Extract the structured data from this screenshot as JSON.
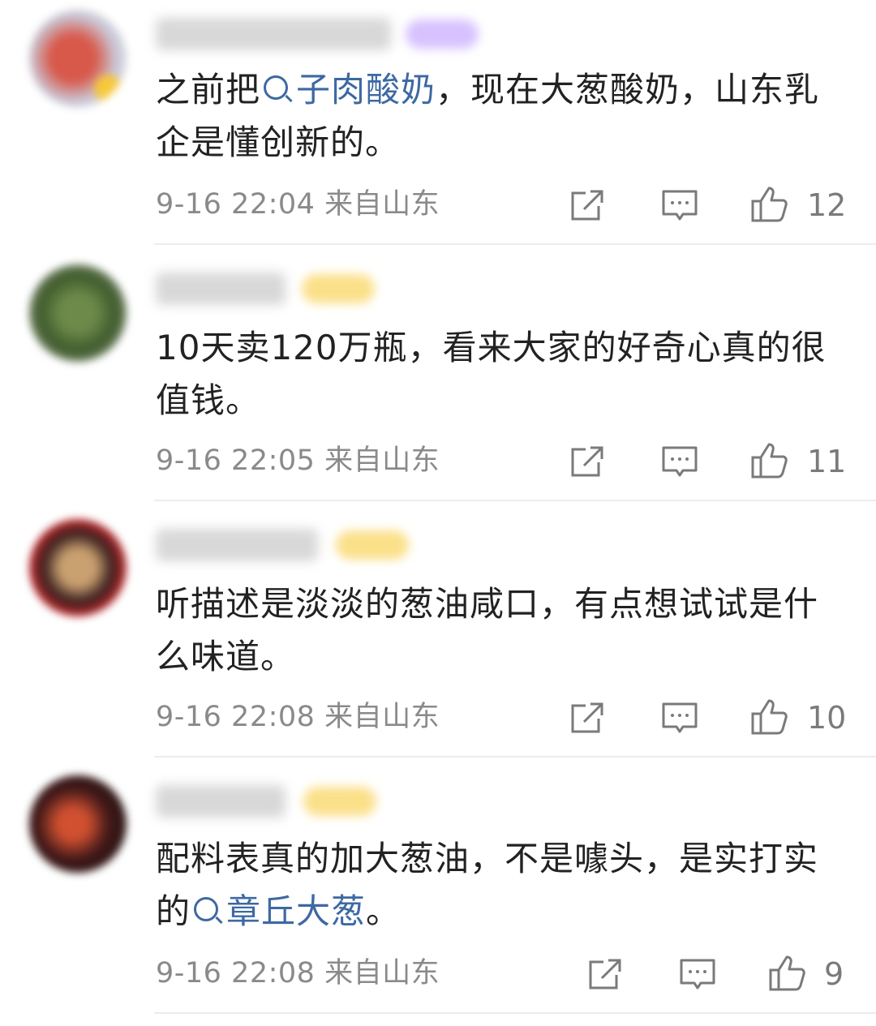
{
  "comments": [
    {
      "segments": [
        {
          "t": "text",
          "v": "之前把"
        },
        {
          "t": "topic",
          "v": "子肉酸奶"
        },
        {
          "t": "text",
          "v": "，现在大葱酸奶，山东乳企是懂创新的。"
        }
      ],
      "time": "9-16 22:04",
      "location": "来自山东",
      "likes": "12"
    },
    {
      "segments": [
        {
          "t": "text",
          "v": "10天卖120万瓶，看来大家的好奇心真的很值钱。"
        }
      ],
      "time": "9-16 22:05",
      "location": "来自山东",
      "likes": "11"
    },
    {
      "segments": [
        {
          "t": "text",
          "v": "听描述是淡淡的葱油咸口，有点想试试是什么味道。"
        }
      ],
      "time": "9-16 22:08",
      "location": "来自山东",
      "likes": "10"
    },
    {
      "segments": [
        {
          "t": "text",
          "v": "配料表真的加大葱油，不是噱头，是实打实的"
        },
        {
          "t": "topic",
          "v": "章丘大葱"
        },
        {
          "t": "text",
          "v": "。"
        }
      ],
      "time": "9-16 22:08",
      "location": "来自山东",
      "likes": "9"
    }
  ],
  "colors": {
    "topic": "#3d69a3",
    "meta": "#8a8a8a",
    "divider": "#ececec",
    "badge_purple": "#d7c2ff",
    "badge_yellow": "#fbe08a"
  },
  "icons": [
    "share-icon",
    "comment-icon",
    "like-icon",
    "search-icon"
  ]
}
